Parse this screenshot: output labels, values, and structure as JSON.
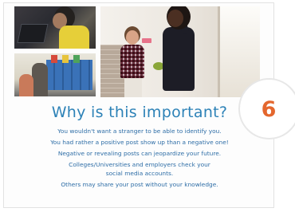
{
  "slide": {
    "headline": "Why is this important?",
    "body_lines": [
      "You wouldn't want  a stranger to be able to identify you.",
      "You had rather a positive post show up than a negative one!",
      "Negative or revealing posts can jeopardize your future.",
      "Colleges/Universities  and employers check your\nsocial media accounts.",
      "Others may share your post without your knowledge."
    ],
    "page_number": "6"
  },
  "colors": {
    "headline": "#2d82b7",
    "body_text": "#2d6da6",
    "badge_number": "#e4672e",
    "badge_border": "#e7e7e7"
  },
  "photos": [
    {
      "name": "teen-at-laptop-photo"
    },
    {
      "name": "students-in-hallway-photo"
    },
    {
      "name": "girls-with-phone-photo"
    }
  ]
}
